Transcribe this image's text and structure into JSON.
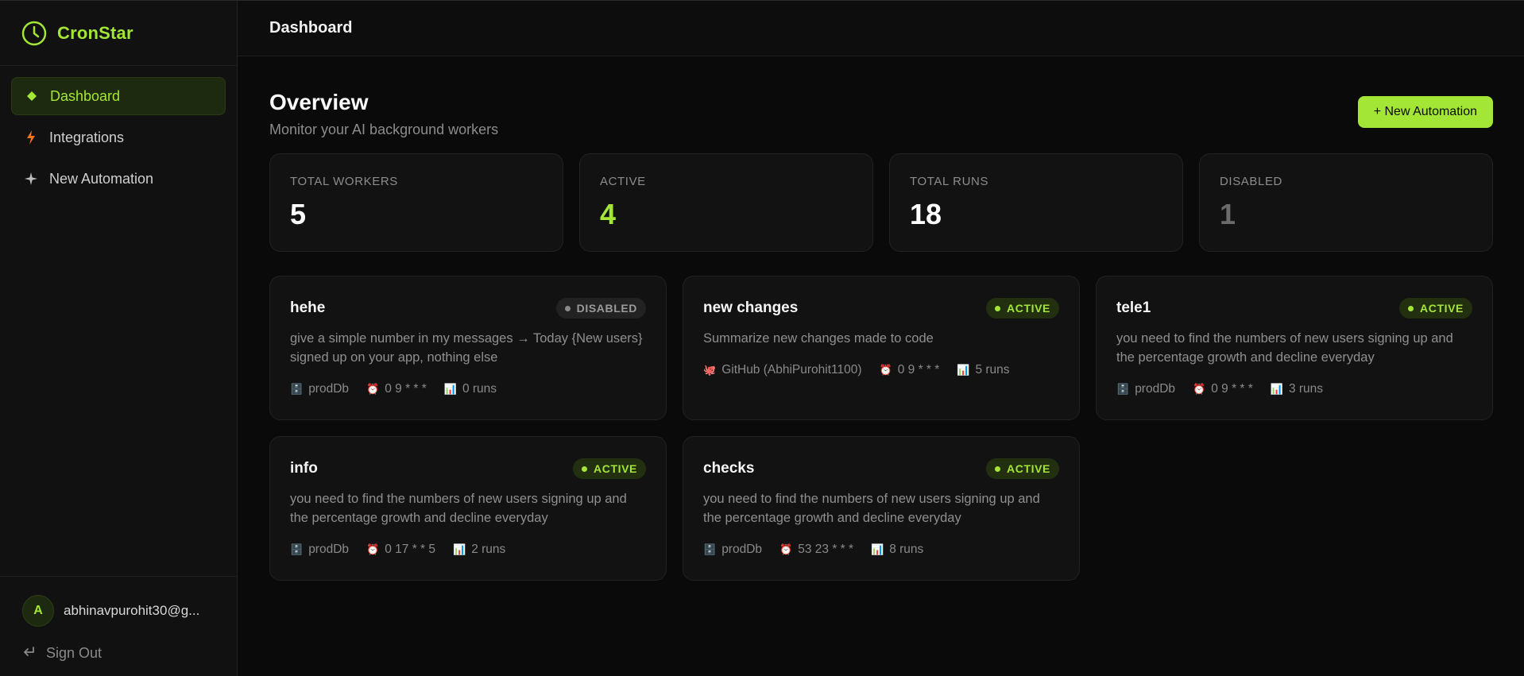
{
  "app": {
    "name": "CronStar"
  },
  "sidebar": {
    "items": [
      {
        "label": "Dashboard",
        "icon": "diamond-icon",
        "active": true
      },
      {
        "label": "Integrations",
        "icon": "bolt-icon"
      },
      {
        "label": "New Automation",
        "icon": "sparkle-icon"
      }
    ],
    "user": {
      "initial": "A",
      "email": "abhinavpurohit30@g..."
    },
    "signout_label": "Sign Out"
  },
  "topbar": {
    "title": "Dashboard"
  },
  "overview": {
    "title": "Overview",
    "subtitle": "Monitor your AI background workers",
    "new_button": "+ New Automation"
  },
  "stats": [
    {
      "label": "TOTAL WORKERS",
      "value": "5"
    },
    {
      "label": "ACTIVE",
      "value": "4"
    },
    {
      "label": "TOTAL RUNS",
      "value": "18"
    },
    {
      "label": "DISABLED",
      "value": "1"
    }
  ],
  "workers": [
    {
      "name": "hehe",
      "status": "DISABLED",
      "desc": "give a simple number in my messages → Today {New users} signed up on your app, nothing else",
      "source": "prodDb",
      "schedule": "0 9 * * *",
      "runs": "0 runs"
    },
    {
      "name": "new changes",
      "status": "ACTIVE",
      "desc": "Summarize new changes made to code",
      "source": "GitHub (AbhiPurohit1100)",
      "schedule": "0 9 * * *",
      "runs": "5 runs"
    },
    {
      "name": "tele1",
      "status": "ACTIVE",
      "desc": "you need to find the numbers of new users signing up and the percentage growth and decline everyday",
      "source": "prodDb",
      "schedule": "0 9 * * *",
      "runs": "3 runs"
    },
    {
      "name": "info",
      "status": "ACTIVE",
      "desc": "you need to find the numbers of new users signing up and the percentage growth and decline everyday",
      "source": "prodDb",
      "schedule": "0 17 * * 5",
      "runs": "2 runs"
    },
    {
      "name": "checks",
      "status": "ACTIVE",
      "desc": "you need to find the numbers of new users signing up and the percentage growth and decline everyday",
      "source": "prodDb",
      "schedule": "53 23 * * *",
      "runs": "8 runs"
    }
  ],
  "colors": {
    "accent": "#a3e635",
    "background": "#0a0a0a",
    "card": "#121212"
  }
}
